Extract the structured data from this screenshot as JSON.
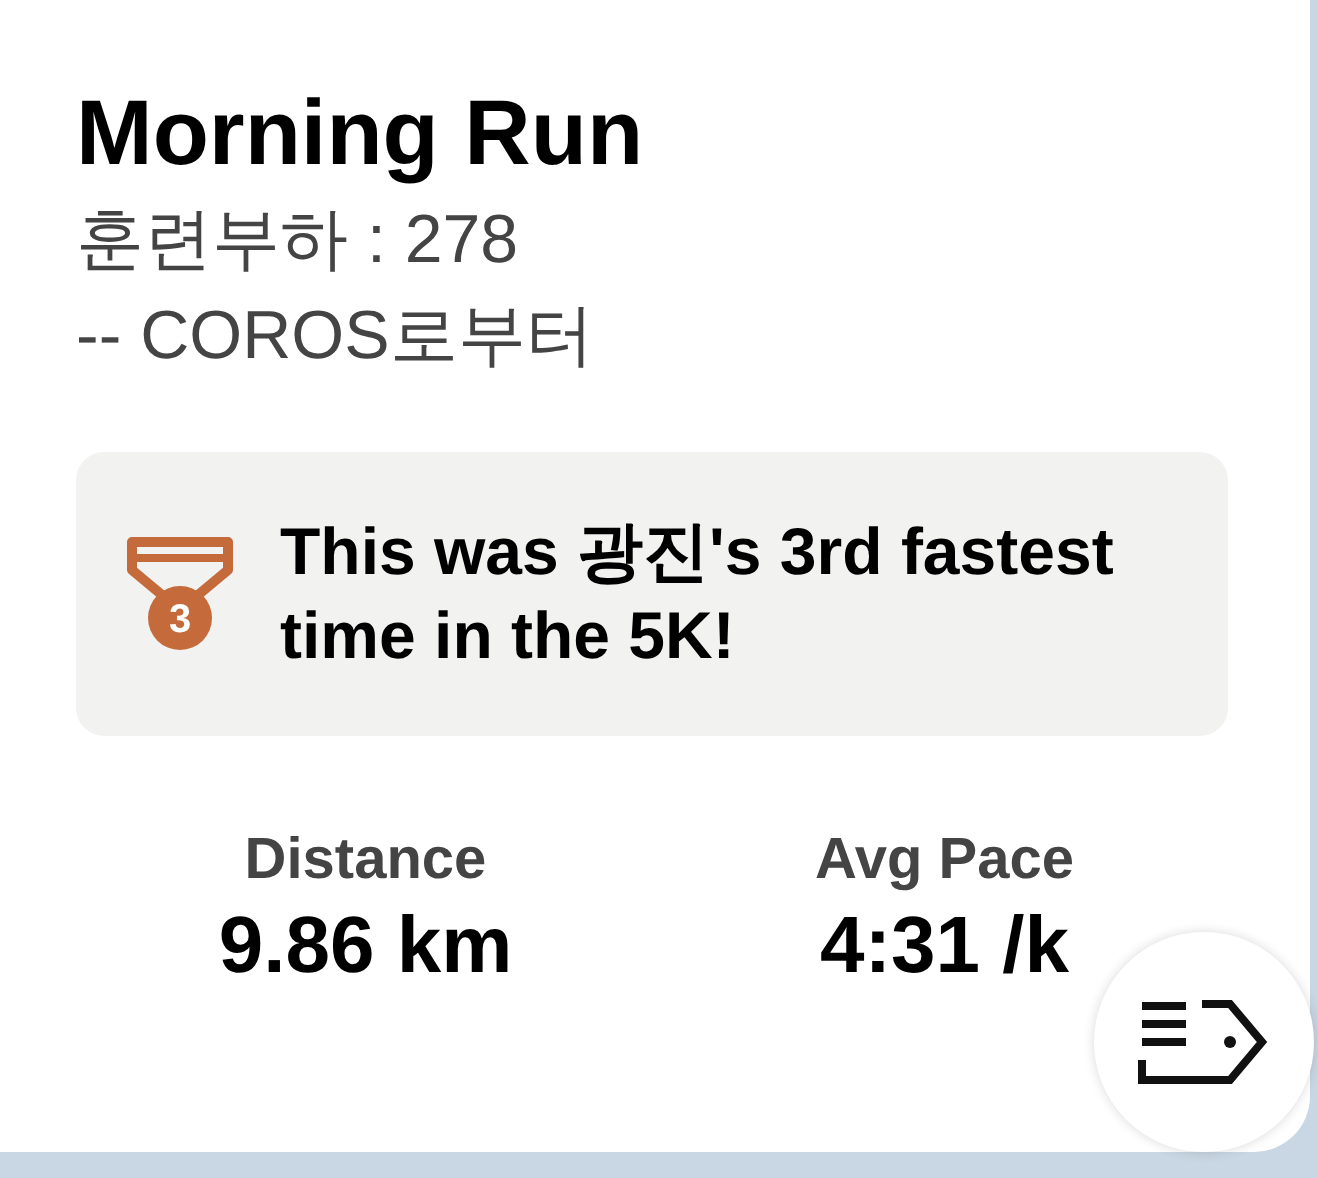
{
  "activity": {
    "title": "Morning Run",
    "lines": [
      "훈련부하 : 278",
      "-- COROS로부터"
    ]
  },
  "achievement": {
    "rank": "3",
    "text": "This was 광진's 3rd fastest time in the 5K!"
  },
  "stats": [
    {
      "label": "Distance",
      "value": "9.86 km"
    },
    {
      "label": "Avg Pace",
      "value": "4:31 /k"
    }
  ]
}
